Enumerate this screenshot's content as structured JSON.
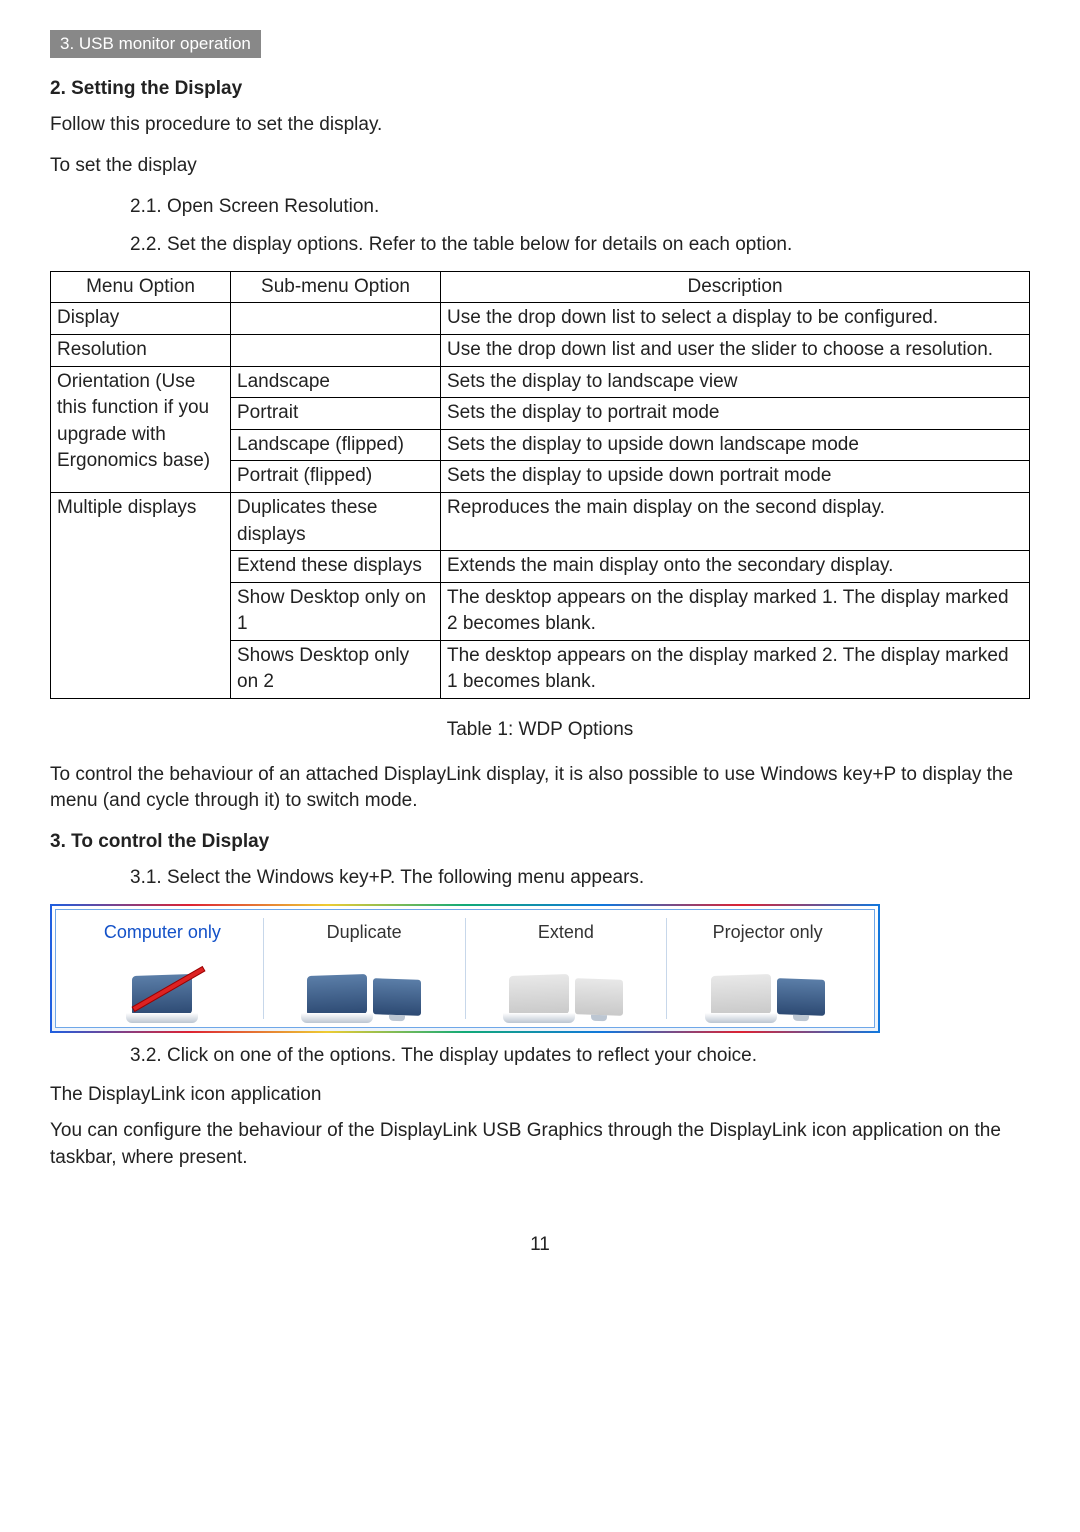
{
  "tab": "3. USB monitor operation",
  "section2_title": "2.   Setting the Display",
  "section2_intro": "Follow this procedure to set the display.",
  "section2_lead": "To set the display",
  "step21": "2.1. Open Screen Resolution.",
  "step22": "2.2. Set the display options. Refer to the table below for details on each option.",
  "table": {
    "headers": {
      "menu": "Menu Option",
      "sub": "Sub-menu Option",
      "desc": "Description"
    },
    "display_row": {
      "menu": "Display",
      "desc": "Use the drop down list to select a display to be configured."
    },
    "resolution_row": {
      "menu": "Resolution",
      "desc": "Use the drop down list and user the slider to choose a resolution."
    },
    "orientation": {
      "menu": "Orientation (Use this function if you upgrade with Ergonomics base)",
      "rows": [
        {
          "sub": "Landscape",
          "desc": "Sets the display to landscape view"
        },
        {
          "sub": "Portrait",
          "desc": "Sets the display to portrait mode"
        },
        {
          "sub": "Landscape (flipped)",
          "desc": "Sets the display to upside down landscape mode"
        },
        {
          "sub": "Portrait (flipped)",
          "desc": "Sets the display to upside down portrait mode"
        }
      ]
    },
    "multiple": {
      "menu": "Multiple displays",
      "rows": [
        {
          "sub": "Duplicates these displays",
          "desc": "Reproduces the main display on the second display."
        },
        {
          "sub": "Extend these displays",
          "desc": "Extends the main display onto the secondary display."
        },
        {
          "sub": "Show Desktop only on 1",
          "desc": "The desktop appears on the display marked 1. The display marked 2 becomes blank."
        },
        {
          "sub": "Shows Desktop only on 2",
          "desc": "The desktop appears on the display marked 2. The display marked 1 becomes blank."
        }
      ]
    }
  },
  "table_caption": "Table 1: WDP Options",
  "after_table": "To control the behaviour of an attached DisplayLink display, it is also possible to use Windows key+P to display the menu (and cycle through it) to switch mode.",
  "section3_title": "3.   To control the Display",
  "step31": "3.1. Select the Windows key+P. The following menu appears.",
  "menu_options": {
    "opt1": "Computer only",
    "opt2": "Duplicate",
    "opt3": "Extend",
    "opt4": "Projector only"
  },
  "step32": "3.2. Click on one of the options. The display updates to reflect your choice.",
  "dl_heading": "The DisplayLink icon application",
  "dl_body": "You can configure the behaviour of the DisplayLink USB Graphics through the DisplayLink icon application on the taskbar, where present.",
  "page_number": "11"
}
